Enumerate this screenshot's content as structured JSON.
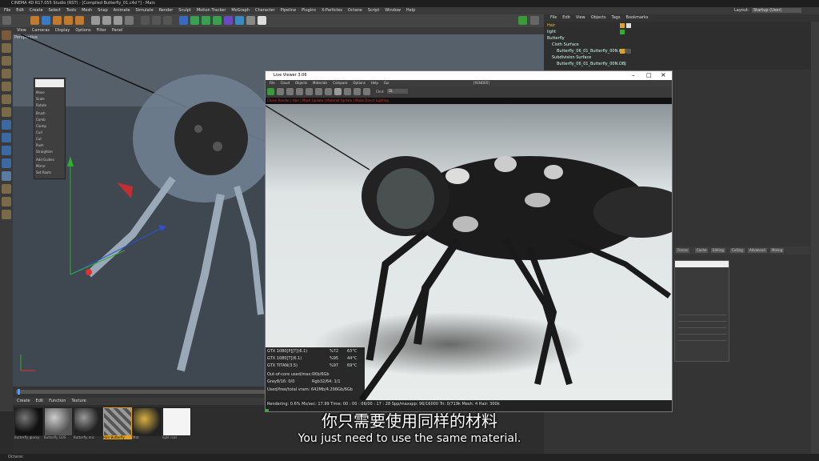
{
  "app": {
    "title": "CINEMA 4D R17.055 Studio (RST) - [Compiled Butterfly_01.c4d *] - Main",
    "menu": [
      "File",
      "Edit",
      "Create",
      "Select",
      "Tools",
      "Mesh",
      "Snap",
      "Animate",
      "Simulate",
      "Render",
      "Sculpt",
      "Motion Tracker",
      "MoGraph",
      "Character",
      "Pipeline",
      "Plugins",
      "X-Particles",
      "Octane",
      "Script",
      "Window",
      "Help"
    ],
    "layout_label": "Layout:",
    "layout_value": "Startup (User)"
  },
  "viewport": {
    "menu": [
      "View",
      "Cameras",
      "Display",
      "Options",
      "Filter",
      "Panel"
    ],
    "camera_label": "Perspective"
  },
  "gear_menu": {
    "items": [
      "Move",
      "Scale",
      "Rotate",
      "Brush",
      "Comb",
      "Clump",
      "Curl",
      "Cut",
      "Push",
      "Straighten",
      "Add Guides",
      "Mirror",
      "Set Roots"
    ]
  },
  "object_manager": {
    "menu": [
      "File",
      "Edit",
      "View",
      "Objects",
      "Tags",
      "Bookmarks"
    ],
    "objects": [
      "Hair",
      "light",
      "Butterfly",
      "Cloth Surface",
      "Butterfly_06_01_Butterfly_00N.OBJ",
      "Subdivision Surface",
      "Butterfly_06_01_Butterfly_00N.OBJ"
    ]
  },
  "attribute_tabs": [
    "Forces",
    "Cache",
    "Editing",
    "Culling",
    "Advanced",
    "Mixing"
  ],
  "material_manager": {
    "menu": [
      "Create",
      "Edit",
      "Function",
      "Texture"
    ],
    "materials": [
      {
        "name": "Butterfly glossy",
        "color": "#2a2a2a"
      },
      {
        "name": "Butterfly GOS",
        "color": "#6a6a6a"
      },
      {
        "name": "Butterfly mic",
        "color": "#3a3a3a"
      },
      {
        "name": "Hair Butterfly",
        "color": "#8a8a8a"
      },
      {
        "name": "Mat",
        "color": "#c9a23a"
      },
      {
        "name": "light mat",
        "color": "#f4f4f4"
      }
    ]
  },
  "live_viewer": {
    "title": "Live Viewer 3.06",
    "menu": [
      "File",
      "Cloud",
      "Objects",
      "Materials",
      "Compare",
      "Options",
      "Help",
      "Gui"
    ],
    "top_label": "[RENDER]",
    "channel_label": "Chnl:",
    "channel_value": "DL",
    "info_line": "Check:Render | Hair | Mesh:Update | Material:Update | Mode:Direct Lighting",
    "gpus": [
      {
        "name": "GTX 1080[P][T](6.1)",
        "usage": "%72",
        "temp": "63°C"
      },
      {
        "name": "GTX 1080[T](6.1)",
        "usage": "%95",
        "temp": "44°C"
      },
      {
        "name": "GTX TITAN(3.5)",
        "usage": "%97",
        "temp": "69°C"
      }
    ],
    "out_of_core": "Out-of-core used/max:0Kb/6Gb",
    "grey": "Grey8/16: 0/0",
    "rgb": "Rgb32/64: 1/1",
    "vram": "Used/free/total vram: 642Mb/4.298Gb/6Gb",
    "status": "Rendering: 0.6%   Ms/sec: 17.99   Time: 00 : 00 : 06/00 : 17 : 28   Spp/maxspp: 96/16000   Tri: 0/719k   Mesh: 4   Hair: 300k"
  },
  "subtitles": {
    "zh": "你只需要使用同样的材料",
    "en": "You just need to use the same material."
  },
  "bottom_status": "Octane:"
}
